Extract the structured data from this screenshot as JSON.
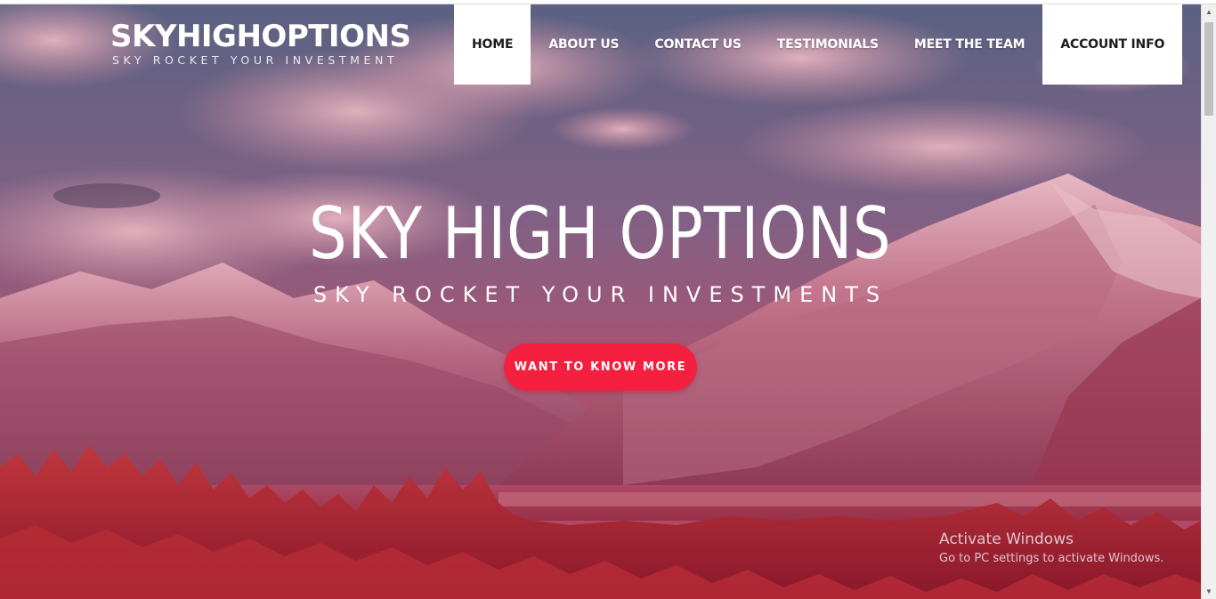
{
  "brand": {
    "title": "SKYHIGHOPTIONS",
    "tagline": "SKY ROCKET YOUR INVESTMENT"
  },
  "nav": {
    "items": [
      {
        "label": "HOME",
        "active": true
      },
      {
        "label": "ABOUT US",
        "active": false
      },
      {
        "label": "CONTACT US",
        "active": false
      },
      {
        "label": "TESTIMONIALS",
        "active": false
      },
      {
        "label": "MEET THE TEAM",
        "active": false
      },
      {
        "label": "ACCOUNT INFO",
        "active": true
      }
    ]
  },
  "hero": {
    "title": "SKY HIGH OPTIONS",
    "subtitle": "SKY ROCKET YOUR INVESTMENTS",
    "cta_label": "WANT TO KNOW MORE"
  },
  "watermark": {
    "title": "Activate Windows",
    "subtitle": "Go to PC settings to activate Windows."
  },
  "colors": {
    "accent": "#f5203f",
    "overlay": "#c0304f",
    "nav_active_bg": "#ffffff"
  },
  "icons": {
    "scroll_up": "triangle-up-icon",
    "scroll_down": "triangle-down-icon"
  }
}
